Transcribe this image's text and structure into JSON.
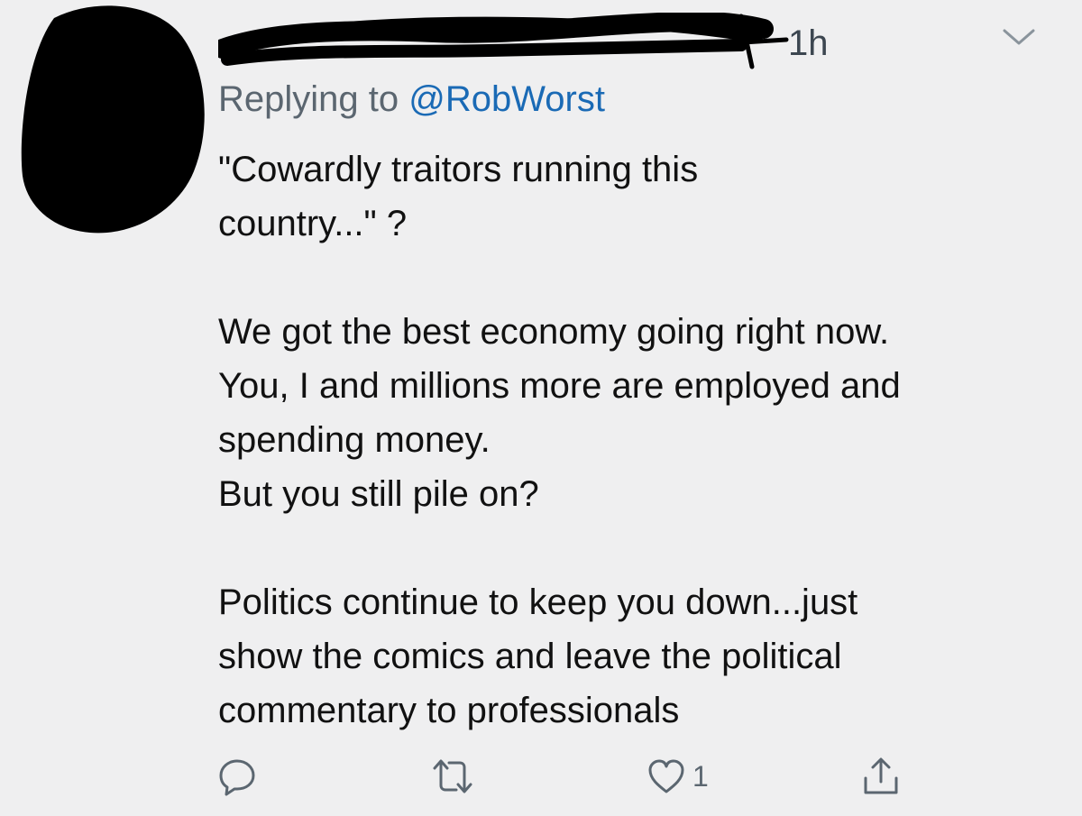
{
  "header": {
    "timestamp": "1h"
  },
  "reply": {
    "prefix": "Replying to ",
    "mention": "@RobWorst"
  },
  "body": {
    "paragraphs": [
      "\"Cowardly traitors running this\ncountry...\"  ?",
      "We got the best economy going right now.\nYou, I and millions more are employed and\nspending money.\nBut you still pile on?",
      "Politics continue to keep you down...just\nshow the comics and leave the political\ncommentary to professionals"
    ]
  },
  "actions": {
    "reply_icon": "reply-icon",
    "retweet_icon": "retweet-icon",
    "like_icon": "heart-icon",
    "like_count": "1",
    "share_icon": "share-icon"
  },
  "colors": {
    "background": "#efeff0",
    "text": "#111111",
    "secondary": "#5b6670",
    "link": "#1a6ab5",
    "redaction": "#000000"
  }
}
